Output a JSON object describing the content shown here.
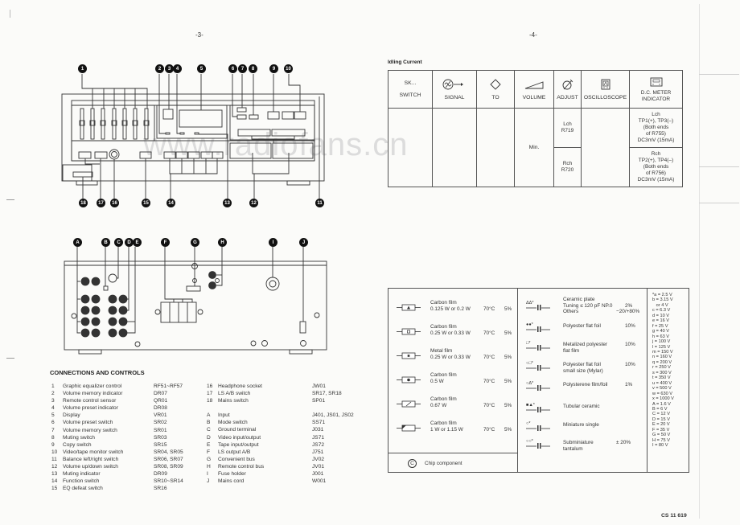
{
  "pages": {
    "left_page_number": "-3-",
    "right_page_number": "-4-"
  },
  "watermark": "www.radiofans.cn",
  "front_panel": {
    "callouts": [
      "1",
      "2",
      "3",
      "4",
      "5",
      "6",
      "7",
      "8",
      "9",
      "10",
      "11",
      "12",
      "13",
      "14",
      "15",
      "16",
      "17",
      "18"
    ]
  },
  "rear_panel": {
    "callouts": [
      "A",
      "B",
      "C",
      "D",
      "E",
      "F",
      "G",
      "H",
      "I",
      "J"
    ]
  },
  "connections_and_controls": {
    "title": "CONNECTIONS AND CONTROLS",
    "left_column": [
      {
        "id": "1",
        "description": "Graphic equalizer control",
        "reference": "RF51~RF57"
      },
      {
        "id": "2",
        "description": "Volume memory indicator",
        "reference": "DR07"
      },
      {
        "id": "3",
        "description": "Remote control sensor",
        "reference": "QR01"
      },
      {
        "id": "4",
        "description": "Volume preset indicator",
        "reference": "DR08"
      },
      {
        "id": "5",
        "description": "Display",
        "reference": "VR01"
      },
      {
        "id": "6",
        "description": "Volume preset switch",
        "reference": "SR02"
      },
      {
        "id": "7",
        "description": "Volume memory switch",
        "reference": "SR01"
      },
      {
        "id": "8",
        "description": "Muting switch",
        "reference": "SR03"
      },
      {
        "id": "9",
        "description": "Copy switch",
        "reference": "SR15"
      },
      {
        "id": "10",
        "description": "Video/tape monitor switch",
        "reference": "SR04, SR05"
      },
      {
        "id": "11",
        "description": "Balance left/right switch",
        "reference": "SR06, SR07"
      },
      {
        "id": "12",
        "description": "Volume up/down switch",
        "reference": "SR08, SR09"
      },
      {
        "id": "13",
        "description": "Muting indicator",
        "reference": "DR09"
      },
      {
        "id": "14",
        "description": "Function switch",
        "reference": "SR10~SR14"
      },
      {
        "id": "15",
        "description": "EQ defeat switch",
        "reference": "SR16"
      }
    ],
    "right_column_numbers": [
      {
        "id": "16",
        "description": "Headphone socket",
        "reference": "JW01"
      },
      {
        "id": "17",
        "description": "LS A/B switch",
        "reference": "SR17, SR18"
      },
      {
        "id": "18",
        "description": "Mains switch",
        "reference": "SP01"
      }
    ],
    "right_column_letters": [
      {
        "id": "A",
        "description": "Input",
        "reference": "J401, JS01, JS02"
      },
      {
        "id": "B",
        "description": "Mode switch",
        "reference": "SS71"
      },
      {
        "id": "C",
        "description": "Ground terminal",
        "reference": "J031"
      },
      {
        "id": "D",
        "description": "Video input/output",
        "reference": "JS71"
      },
      {
        "id": "E",
        "description": "Tape input/output",
        "reference": "JS72"
      },
      {
        "id": "F",
        "description": "LS output A/B",
        "reference": "J751"
      },
      {
        "id": "G",
        "description": "Convenient bus",
        "reference": "JV02"
      },
      {
        "id": "H",
        "description": "Remote control bus",
        "reference": "JV01"
      },
      {
        "id": "I",
        "description": "Fuse holder",
        "reference": "J001"
      },
      {
        "id": "J",
        "description": "Mains cord",
        "reference": "W001"
      }
    ]
  },
  "idling_current": {
    "title": "Idling Current",
    "headers": [
      {
        "top": "SK...",
        "label": "SWITCH",
        "icon": "switch-text"
      },
      {
        "label": "SIGNAL",
        "icon": "signal-generator-off-icon"
      },
      {
        "label": "TO",
        "icon": "diamond-icon"
      },
      {
        "label": "VOLUME",
        "icon": "volume-wedge-icon"
      },
      {
        "label": "ADJUST",
        "icon": "adjust-potentiometer-icon"
      },
      {
        "label": "OSCILLOSCOPE",
        "icon": "oscilloscope-icon"
      },
      {
        "label": "D.C. METER INDICATOR",
        "icon": "dc-meter-icon"
      }
    ],
    "volume_value": "Min.",
    "rows": [
      {
        "adjust": [
          "Lch",
          "R719"
        ],
        "meter": [
          "Lch",
          "TP1(+), TP3(–)",
          "(Both ends",
          "of R755)",
          "DC3mV (15mA)"
        ]
      },
      {
        "adjust": [
          "Rch",
          "R720"
        ],
        "meter": [
          "Rch",
          "TP2(+), TP4(–)",
          "(Both ends",
          "of R756)",
          "DC3mV (15mA)"
        ]
      }
    ]
  },
  "component_legend": {
    "resistors": [
      {
        "type": "Carbon film",
        "rating": "0.125 W or 0.2 W",
        "temp": "70°C",
        "tolerance": "5%",
        "mark": "triangle"
      },
      {
        "type": "Carbon film",
        "rating": "0.25 W or 0.33 W",
        "temp": "70°C",
        "tolerance": "5%",
        "mark": "square"
      },
      {
        "type": "Metal film",
        "rating": "0.25 W or 0.33 W",
        "temp": "70°C",
        "tolerance": "5%",
        "mark": "dot"
      },
      {
        "type": "Carbon film",
        "rating": "0.5 W",
        "temp": "70°C",
        "tolerance": "5%",
        "mark": "big-dot"
      },
      {
        "type": "Carbon film",
        "rating": "0.67 W",
        "temp": "70°C",
        "tolerance": "5%",
        "mark": "slash"
      },
      {
        "type": "Carbon film",
        "rating": "1 W or 1.15 W",
        "temp": "70°C",
        "tolerance": "5%",
        "mark": "corner"
      }
    ],
    "chip_component": {
      "symbol": "C",
      "label": "Chip component"
    },
    "capacitors": [
      {
        "marks": "ΔΔ*",
        "lines": [
          "Ceramic plate",
          "Tuning ≤ 120 pF NP.0",
          "Others"
        ],
        "tolerance": [
          "",
          "2%",
          "−20/+80%"
        ]
      },
      {
        "marks": "●●*",
        "lines": [
          "Polyester flat foil"
        ],
        "tolerance": [
          "10%"
        ]
      },
      {
        "marks": "□*",
        "lines": [
          "Metalized polyester",
          "flat film"
        ],
        "tolerance": [
          "10%"
        ]
      },
      {
        "marks": "○□*",
        "lines": [
          "Polyester flat foil",
          "small size (Mylar)"
        ],
        "tolerance": [
          "10%"
        ]
      },
      {
        "marks": "○Δ*",
        "lines": [
          "Polysterene film/foil"
        ],
        "tolerance": [
          "1%"
        ]
      },
      {
        "marks": "■▲*",
        "lines": [
          "Tubular ceramic"
        ],
        "tolerance": [
          ""
        ]
      },
      {
        "marks": "○*",
        "lines": [
          "Miniature single"
        ],
        "tolerance": [
          ""
        ]
      },
      {
        "marks": "○○*",
        "lines": [
          "Subminiature",
          "tantalum"
        ],
        "tolerance": [
          "± 20%"
        ]
      }
    ],
    "voltage_codes": [
      "*a = 2.5 V",
      "b = 3.15 V",
      "   or 4 V",
      "c = 6.3 V",
      "d = 10 V",
      "e = 16 V",
      "f = 25 V",
      "g = 40 V",
      "h = 63 V",
      "j = 100 V",
      "l = 125 V",
      "m = 150 V",
      "n = 160 V",
      "q = 200 V",
      "r = 250 V",
      "s = 300 V",
      "t = 350 V",
      "u = 400 V",
      "v = 500 V",
      "w = 630 V",
      "x = 1000 V",
      "A = 1.6 V",
      "B = 6 V",
      "C = 12 V",
      "D = 15 V",
      "E = 20 V",
      "F = 35 V",
      "G = 50 V",
      "H = 75 V",
      "I = 80 V"
    ]
  },
  "document_code": "CS 11 619"
}
